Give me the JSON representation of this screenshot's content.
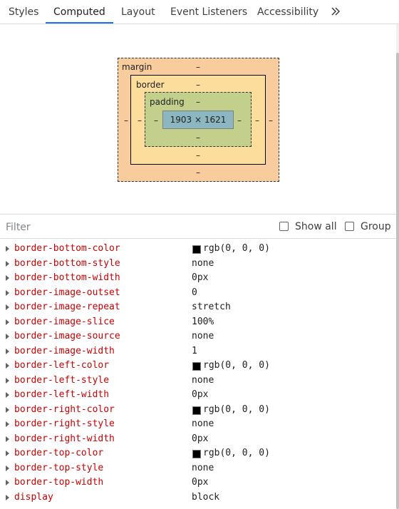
{
  "tabs": [
    {
      "label": "Styles"
    },
    {
      "label": "Computed"
    },
    {
      "label": "Layout"
    },
    {
      "label": "Event Listeners"
    },
    {
      "label": "Accessibility"
    }
  ],
  "more_tabs_icon": "chevron-double-right-icon",
  "box_model": {
    "margin_label": "margin",
    "border_label": "border",
    "padding_label": "padding",
    "dash": "–",
    "content_size": "1903 × 1621",
    "colors": {
      "margin": "#f9cc9d",
      "border": "#fddd9b",
      "padding": "#c3d08b",
      "content": "#8cb6c0"
    }
  },
  "filter": {
    "placeholder": "Filter",
    "show_all_label": "Show all",
    "group_label": "Group"
  },
  "properties": [
    {
      "name": "border-bottom-color",
      "value": "rgb(0, 0, 0)",
      "swatch": "#000000"
    },
    {
      "name": "border-bottom-style",
      "value": "none"
    },
    {
      "name": "border-bottom-width",
      "value": "0px"
    },
    {
      "name": "border-image-outset",
      "value": "0"
    },
    {
      "name": "border-image-repeat",
      "value": "stretch"
    },
    {
      "name": "border-image-slice",
      "value": "100%"
    },
    {
      "name": "border-image-source",
      "value": "none"
    },
    {
      "name": "border-image-width",
      "value": "1"
    },
    {
      "name": "border-left-color",
      "value": "rgb(0, 0, 0)",
      "swatch": "#000000"
    },
    {
      "name": "border-left-style",
      "value": "none"
    },
    {
      "name": "border-left-width",
      "value": "0px"
    },
    {
      "name": "border-right-color",
      "value": "rgb(0, 0, 0)",
      "swatch": "#000000"
    },
    {
      "name": "border-right-style",
      "value": "none"
    },
    {
      "name": "border-right-width",
      "value": "0px"
    },
    {
      "name": "border-top-color",
      "value": "rgb(0, 0, 0)",
      "swatch": "#000000"
    },
    {
      "name": "border-top-style",
      "value": "none"
    },
    {
      "name": "border-top-width",
      "value": "0px"
    },
    {
      "name": "display",
      "value": "block"
    }
  ]
}
